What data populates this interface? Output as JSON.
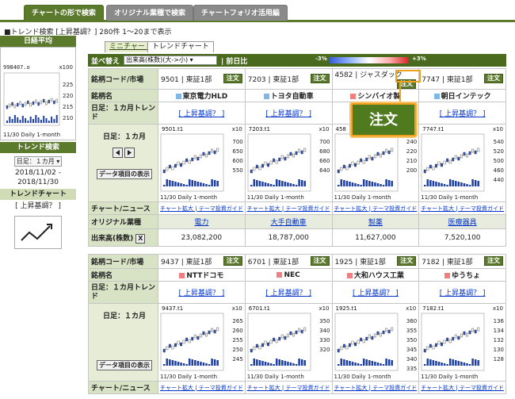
{
  "nav_tabs": [
    "チャートの形で検索",
    "オリジナル業種で検索",
    "チャートフォリオ活用編"
  ],
  "breadcrumb": "■トレンド検索 [上昇基調？] 280件 1〜20まで表示",
  "sidebar": {
    "index_title": "日経平均",
    "index_value": "998407.o",
    "index_scale": "x100",
    "index_ticks": [
      "225",
      "220",
      "215",
      "210"
    ],
    "index_caption": "11/30 Daily 1-month",
    "trend_title": "トレンド検索",
    "period_select": "日足：１カ月",
    "date_from": "2018/11/02 -",
    "date_to": "2018/11/30",
    "trend_chart_title": "トレンドチャート",
    "trend_chart_label": "[ 上昇基調？ ]"
  },
  "view_tabs": [
    "ミニチャート",
    "トレンドチャート"
  ],
  "sortbar": {
    "label": "並べ替え",
    "select": "出来高(株数)(大->小)",
    "prev_label": "| 前日比",
    "minus": "-3%",
    "plus": "+3%"
  },
  "row_labels": {
    "code": "銘柄コード/市場",
    "name": "銘柄名",
    "trend": "日足：１カ月トレンド",
    "daily": "日足：１カ月",
    "data_btn": "データ項目の表示",
    "news": "チャート/ニュース",
    "industry": "オリジナル業種",
    "volume": "出来高(株数)"
  },
  "order_label": "注文",
  "trend_link": "上昇基調？",
  "news_links": [
    "チャート拡大",
    "テーマ投資ガイド"
  ],
  "caption": "11/30 Daily 1-month",
  "popup_label": "注文",
  "stocks_top": [
    {
      "code": "9501 | 東証1部",
      "name": "東京電力HLD",
      "chart_code": "9501.t1",
      "scale": "x10",
      "ticks": [
        "700",
        "650",
        "600",
        "550"
      ],
      "industry": "電力",
      "volume": "23,082,200",
      "color": "#7fb8e8"
    },
    {
      "code": "7203 | 東証1部",
      "name": "トヨタ自動車",
      "chart_code": "7203.t1",
      "scale": "x10",
      "ticks": [
        "700",
        "680",
        "660",
        "640"
      ],
      "industry": "大手自動車",
      "volume": "18,787,000",
      "color": "#7fb8e8"
    },
    {
      "code": "4582 | ジャスダック",
      "name": "シンバイオ製",
      "chart_code": "458",
      "scale": "x10",
      "ticks": [
        "240",
        "220",
        "210",
        "200"
      ],
      "industry": "製薬",
      "volume": "11,627,000",
      "color": "#f08080"
    },
    {
      "code": "7747 | 東証1部",
      "name": "朝日インテック",
      "chart_code": "7747.t1",
      "scale": "x10",
      "ticks": [
        "540",
        "520",
        "500",
        "460",
        "440"
      ],
      "industry": "医療器具",
      "volume": "7,520,100",
      "color": "#7fb8e8"
    }
  ],
  "stocks_bottom": [
    {
      "code": "9437 | 東証1部",
      "name": "NTTドコモ",
      "chart_code": "9437.t1",
      "scale": "x10",
      "ticks": [
        "265",
        "260",
        "255",
        "250",
        "245"
      ],
      "color": "#f08080"
    },
    {
      "code": "6701 | 東証1部",
      "name": "NEC",
      "chart_code": "6701.t1",
      "scale": "x10",
      "ticks": [
        "350",
        "340",
        "330",
        "320"
      ],
      "color": "#f08080"
    },
    {
      "code": "1925 | 東証1部",
      "name": "大和ハウス工業",
      "chart_code": "1925.t1",
      "scale": "x10",
      "ticks": [
        "360",
        "355",
        "350",
        "345",
        "340",
        "335"
      ],
      "color": "#f08080"
    },
    {
      "code": "7182 | 東証1部",
      "name": "ゆうちょ",
      "chart_code": "7182.t1",
      "scale": "x10",
      "ticks": [
        "136",
        "134",
        "132",
        "130",
        "128"
      ],
      "color": "#f08080"
    }
  ]
}
